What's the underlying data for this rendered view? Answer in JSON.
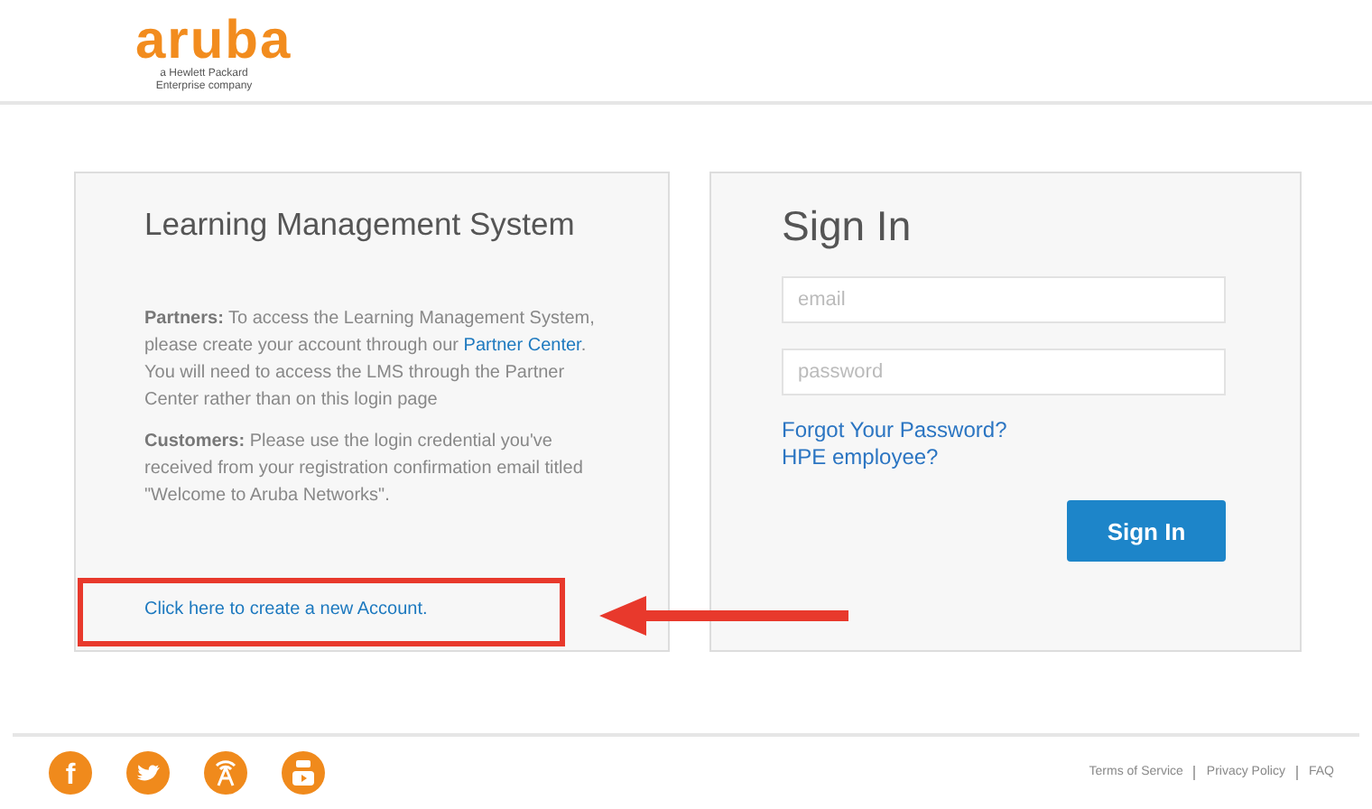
{
  "header": {
    "logo": "aruba",
    "tagline": [
      "a Hewlett Packard",
      "Enterprise company"
    ]
  },
  "info_panel": {
    "title": "Learning Management System",
    "partners": {
      "label": "Partners:",
      "before": " To access the Learning Management System, please create your account through our ",
      "link": "Partner Center",
      "after": ". You will need to access the LMS through the Partner Center rather than on this login page"
    },
    "customers": {
      "label": "Customers:",
      "text": " Please use the login credential you've received from your registration confirmation email titled \"Welcome to Aruba Networks\"."
    },
    "create_account_link": "Click here to create a new Account."
  },
  "sign_in_panel": {
    "title": "Sign In",
    "email": {
      "placeholder": "email"
    },
    "password": {
      "placeholder": "password"
    },
    "links": [
      "Forgot Your Password?",
      "HPE employee?"
    ],
    "button": "Sign In"
  },
  "footer": {
    "social": [
      {
        "kind": "facebook",
        "glyph": "f"
      },
      {
        "kind": "twitter"
      },
      {
        "kind": "tower"
      },
      {
        "kind": "youtube"
      }
    ],
    "links": [
      "Terms of Service",
      "Privacy Policy",
      "FAQ"
    ]
  }
}
